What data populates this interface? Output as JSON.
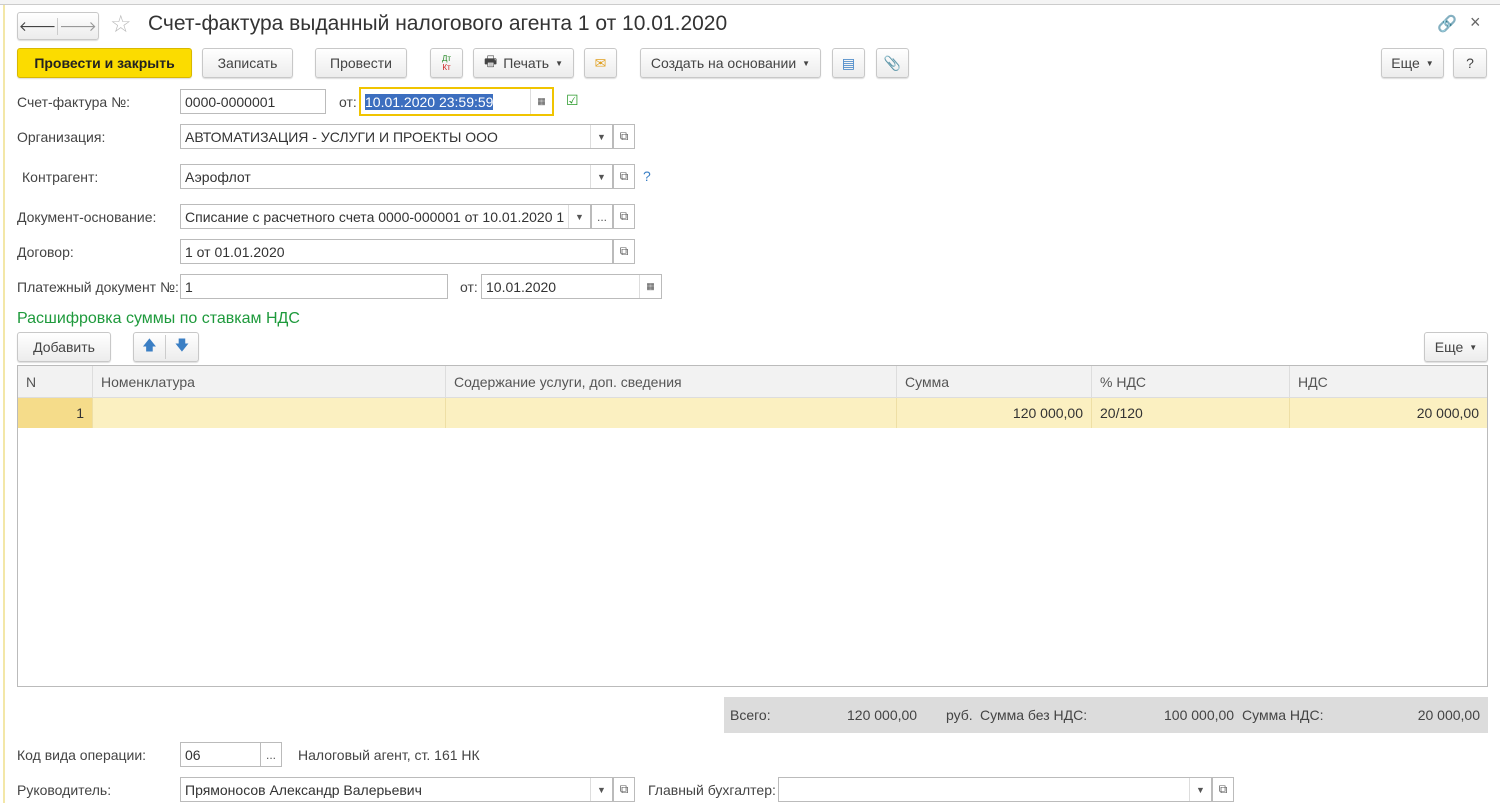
{
  "window": {
    "title": "Счет-фактура выданный налогового агента 1 от 10.01.2020"
  },
  "toolbar": {
    "post_close": "Провести и закрыть",
    "save": "Записать",
    "post": "Провести",
    "dtkt_top": "Дт",
    "dtkt_bottom": "Кт",
    "print": "Печать",
    "create_based": "Создать на основании",
    "more": "Еще",
    "help": "?"
  },
  "form": {
    "invoice_label": "Счет-фактура №:",
    "invoice_number": "0000-0000001",
    "from_label": "от:",
    "invoice_date": "10.01.2020 23:59:59",
    "org_label": "Организация:",
    "org_value": "АВТОМАТИЗАЦИЯ - УСЛУГИ И ПРОЕКТЫ ООО",
    "counterparty_label": "Контрагент:",
    "counterparty_value": "Аэрофлот",
    "counterparty_hint": "?",
    "basis_label": "Документ-основание:",
    "basis_value": "Списание с расчетного счета 0000-000001 от 10.01.2020 1",
    "contract_label": "Договор:",
    "contract_value": "1 от 01.01.2020",
    "payment_label": "Платежный документ №:",
    "payment_number": "1",
    "payment_from_label": "от:",
    "payment_date": "10.01.2020"
  },
  "table": {
    "section_title": "Расшифровка суммы по ставкам НДС",
    "add": "Добавить",
    "more": "Еще",
    "columns": [
      "N",
      "Номенклатура",
      "Содержание услуги, доп. сведения",
      "Сумма",
      "% НДС",
      "НДС"
    ],
    "rows": [
      {
        "n": "1",
        "item": "",
        "content": "",
        "sum": "120 000,00",
        "rate": "20/120",
        "vat": "20 000,00"
      }
    ]
  },
  "totals": {
    "total_label": "Всего:",
    "total": "120 000,00",
    "currency": "руб.",
    "net_label": "Сумма без НДС:",
    "net": "100 000,00",
    "vat_label": "Сумма НДС:",
    "vat": "20 000,00"
  },
  "footer": {
    "op_label": "Код вида операции:",
    "op_code": "06",
    "op_desc": "Налоговый агент, ст. 161 НК",
    "head_label": "Руководитель:",
    "head_value": "Прямоносов Александр Валерьевич",
    "accountant_label": "Главный бухгалтер:",
    "accountant_value": ""
  }
}
